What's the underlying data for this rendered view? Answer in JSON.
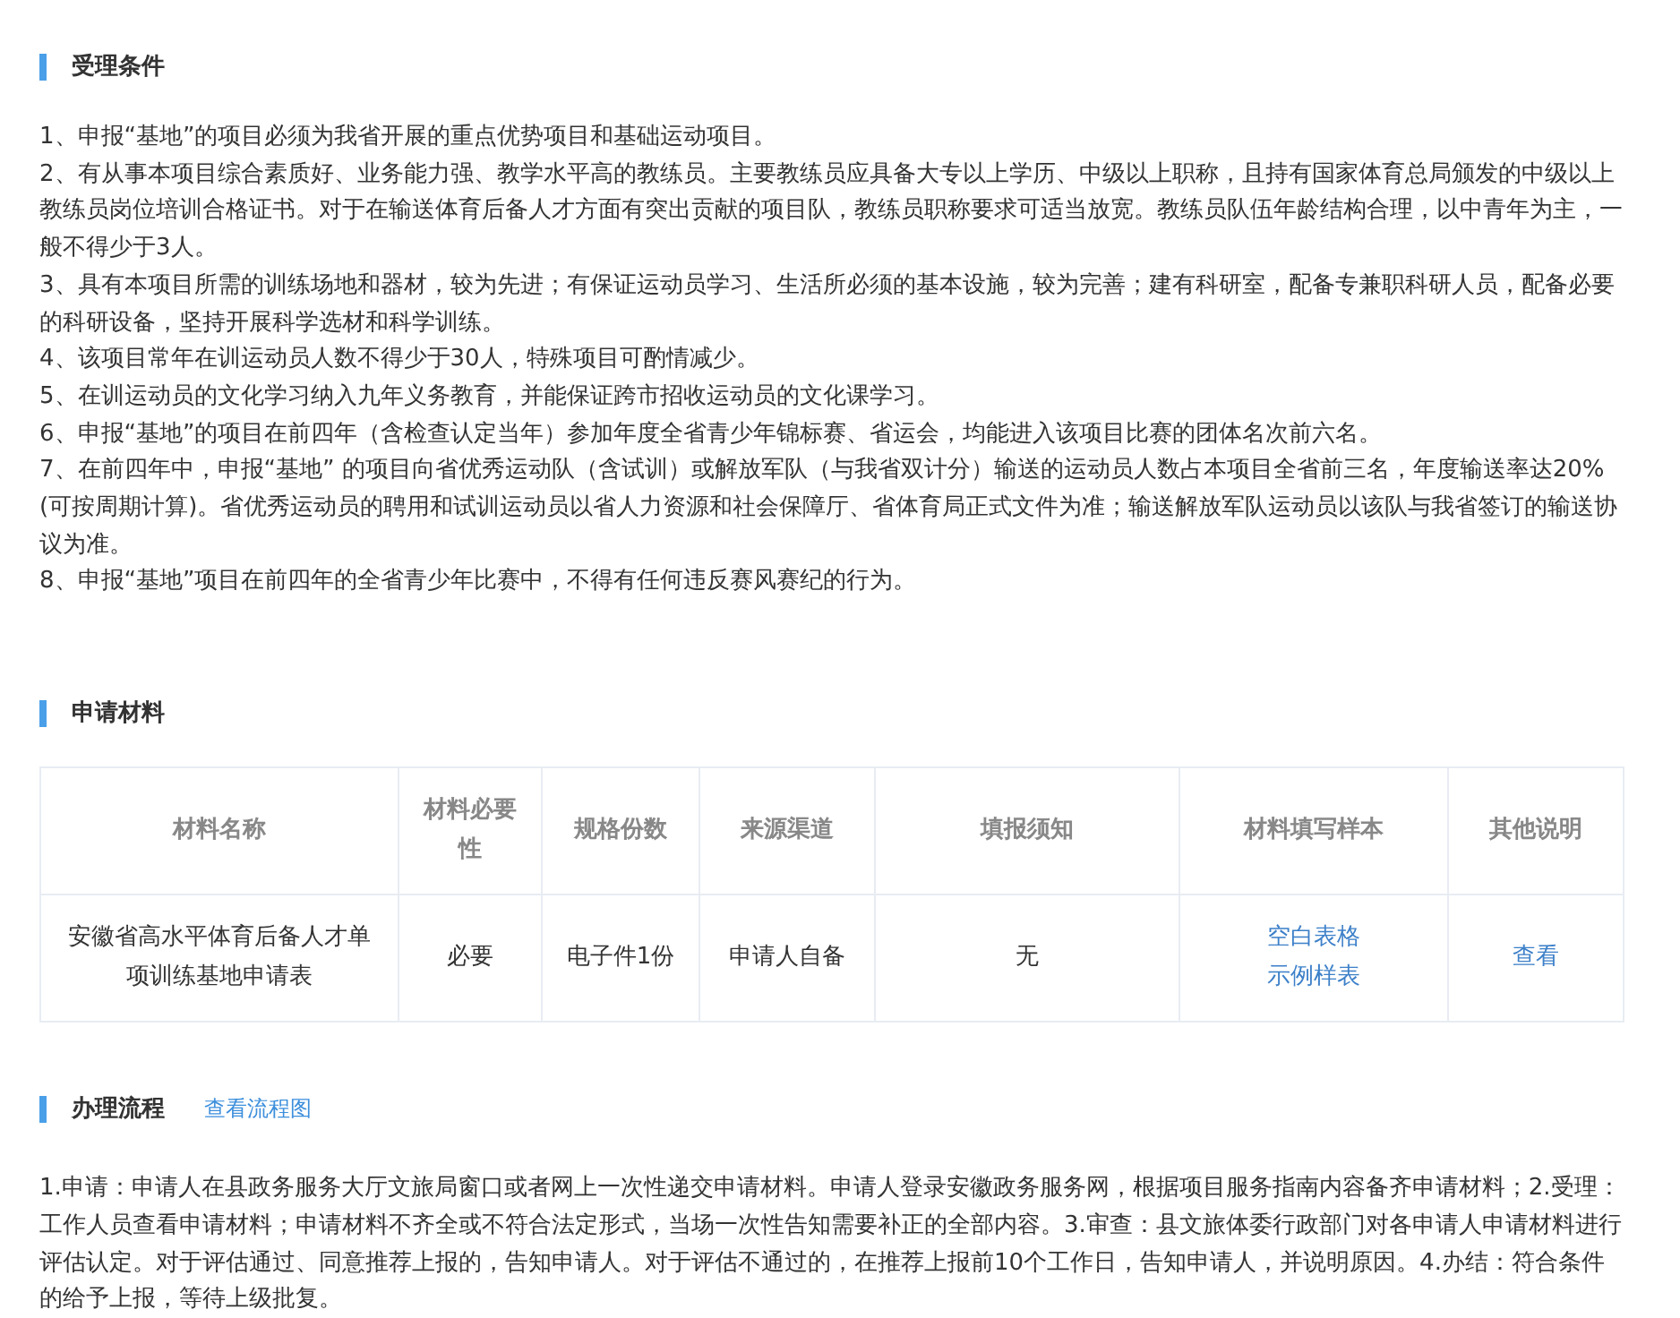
{
  "conditions": {
    "title": "受理条件",
    "items": [
      "1、申报“基地”的项目必须为我省开展的重点优势项目和基础运动项目。",
      "2、有从事本项目综合素质好、业务能力强、教学水平高的教练员。主要教练员应具备大专以上学历、中级以上职称，且持有国家体育总局颁发的中级以上教练员岗位培训合格证书。对于在输送体育后备人才方面有突出贡献的项目队，教练员职称要求可适当放宽。教练员队伍年龄结构合理，以中青年为主，一般不得少于3人。",
      "3、具有本项目所需的训练场地和器材，较为先进；有保证运动员学习、生活所必须的基本设施，较为完善；建有科研室，配备专兼职科研人员，配备必要的科研设备，坚持开展科学选材和科学训练。",
      "4、该项目常年在训运动员人数不得少于30人，特殊项目可酌情减少。",
      "5、在训运动员的文化学习纳入九年义务教育，并能保证跨市招收运动员的文化课学习。",
      "6、申报“基地”的项目在前四年（含检查认定当年）参加年度全省青少年锦标赛、省运会，均能进入该项目比赛的团体名次前六名。",
      "7、在前四年中，申报“基地” 的项目向省优秀运动队（含试训）或解放军队（与我省双计分）输送的运动员人数占本项目全省前三名，年度输送率达20%(可按周期计算)。省优秀运动员的聘用和试训运动员以省人力资源和社会保障厅、省体育局正式文件为准；输送解放军队运动员以该队与我省签订的输送协议为准。",
      "8、申报“基地”项目在前四年的全省青少年比赛中，不得有任何违反赛风赛纪的行为。"
    ]
  },
  "materials": {
    "title": "申请材料",
    "table": {
      "columns": [
        "材料名称",
        "材料必要性",
        "规格份数",
        "来源渠道",
        "填报须知",
        "材料填写样本",
        "其他说明"
      ],
      "rows": [
        {
          "cells": [
            {
              "kind": "text",
              "text": "安徽省高水平体育后备人才单项训练基地申请表"
            },
            {
              "kind": "text",
              "text": "必要"
            },
            {
              "kind": "text",
              "text": "电子件1份"
            },
            {
              "kind": "text",
              "text": "申请人自备"
            },
            {
              "kind": "text",
              "text": "无"
            },
            {
              "kind": "links",
              "links": [
                "空白表格",
                "示例样表"
              ]
            },
            {
              "kind": "links",
              "links": [
                "查看"
              ]
            }
          ]
        }
      ]
    }
  },
  "process": {
    "title": "办理流程",
    "link": "查看流程图",
    "text": "1.申请：申请人在县政务服务大厅文旅局窗口或者网上一次性递交申请材料。申请人登录安徽政务服务网，根据项目服务指南内容备齐申请材料；2.受理：工作人员查看申请材料；申请材料不齐全或不符合法定形式，当场一次性告知需要补正的全部内容。3.审查：县文旅体委行政部门对各申请人申请材料进行评估认定。对于评估通过、同意推荐上报的，告知申请人。对于评估不通过的，在推荐上报前10个工作日，告知申请人，并说明原因。4.办结：符合条件的给予上报，等待上级批复。"
  }
}
